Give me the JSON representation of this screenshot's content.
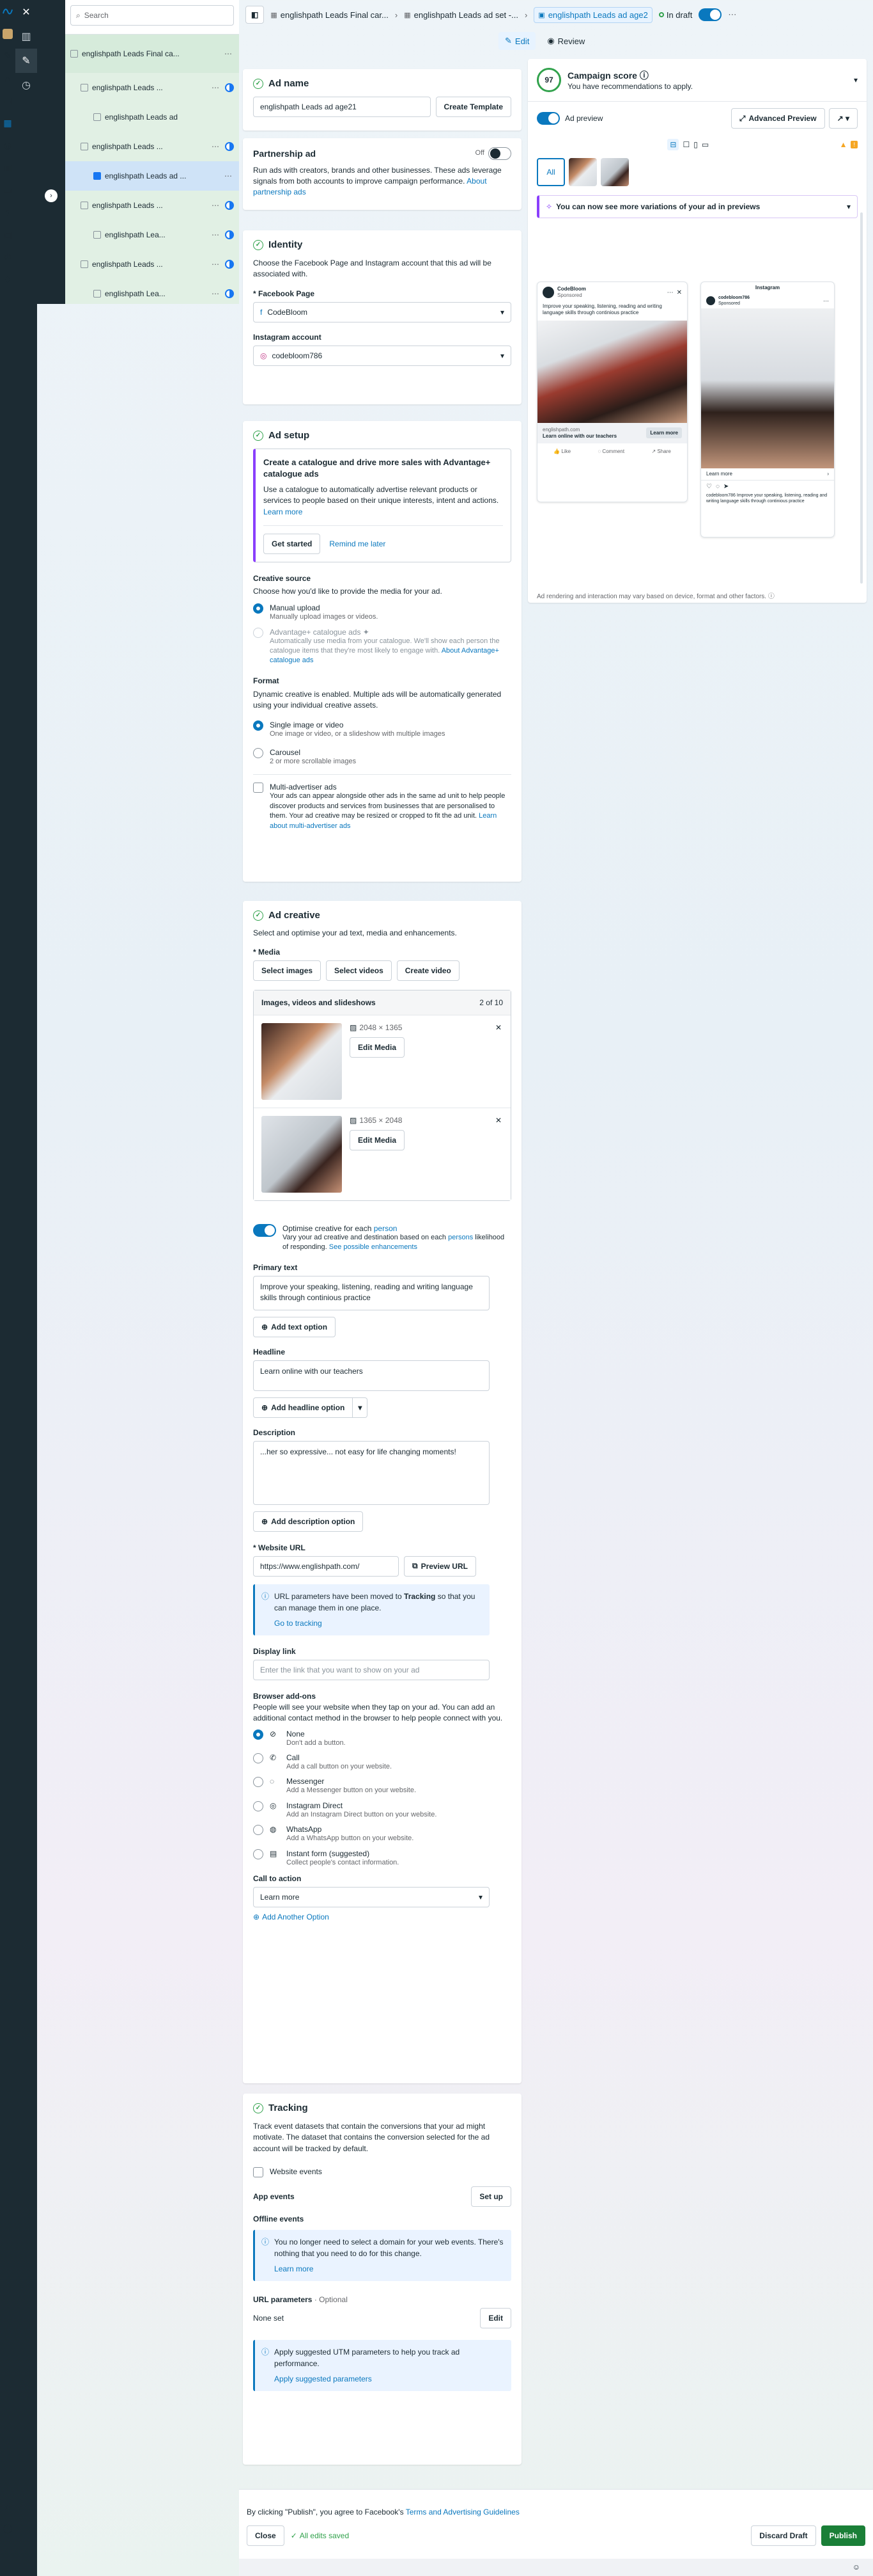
{
  "search": {
    "placeholder": "Search"
  },
  "tree": {
    "items": [
      {
        "label": "englishpath Leads Final ca..."
      },
      {
        "label": "englishpath Leads ..."
      },
      {
        "label": "englishpath Leads ad"
      },
      {
        "label": "englishpath Leads ..."
      },
      {
        "label": "englishpath Leads ad ..."
      },
      {
        "label": "englishpath Leads ..."
      },
      {
        "label": "englishpath Lea..."
      },
      {
        "label": "englishpath Leads ..."
      },
      {
        "label": "englishpath Lea..."
      }
    ]
  },
  "topbar": {
    "crumb1": "englishpath Leads Final car...",
    "crumb2": "englishpath Leads ad set -...",
    "crumb3": "englishpath Leads ad age2",
    "status": "In draft",
    "edit": "Edit",
    "review": "Review"
  },
  "adname": {
    "title": "Ad name",
    "value": "englishpath Leads ad age21",
    "create_template": "Create Template"
  },
  "partnership": {
    "title": "Partnership ad",
    "toggle": "Off",
    "desc": "Run ads with creators, brands and other businesses. These ads leverage signals from both accounts to improve campaign performance.",
    "link": "About partnership ads"
  },
  "identity": {
    "title": "Identity",
    "desc": "Choose the Facebook Page and Instagram account that this ad will be associated with.",
    "fb_label": "* Facebook Page",
    "fb_value": "CodeBloom",
    "ig_label": "Instagram account",
    "ig_value": "codebloom786"
  },
  "adsetup": {
    "title": "Ad setup",
    "promo_title": "Create a catalogue and drive more sales with Advantage+ catalogue ads",
    "promo_desc": "Use a catalogue to automatically advertise relevant products or services to people based on their unique interests, intent and actions.",
    "promo_link": "Learn more",
    "get_started": "Get started",
    "remind": "Remind me later",
    "creative_source": "Creative source",
    "creative_source_desc": "Choose how you'd like to provide the media for your ad.",
    "manual_title": "Manual upload",
    "manual_desc": "Manually upload images or videos.",
    "adv_title": "Advantage+ catalogue ads",
    "adv_desc": "Automatically use media from your catalogue. We'll show each person the catalogue items that they're most likely to engage with.",
    "adv_link": "About Advantage+ catalogue ads",
    "format": "Format",
    "format_desc": "Dynamic creative is enabled. Multiple ads will be automatically generated using your individual creative assets.",
    "single_title": "Single image or video",
    "single_desc": "One image or video, or a slideshow with multiple images",
    "carousel_title": "Carousel",
    "carousel_desc": "2 or more scrollable images",
    "multi_title": "Multi-advertiser ads",
    "multi_desc": "Your ads can appear alongside other ads in the same ad unit to help people discover products and services from businesses that are personalised to them. Your ad creative may be resized or cropped to fit the ad unit.",
    "multi_link": "Learn about multi-advertiser ads"
  },
  "creative": {
    "title": "Ad creative",
    "desc": "Select and optimise your ad text, media and enhancements.",
    "media_label": "* Media",
    "select_images": "Select images",
    "select_videos": "Select videos",
    "create_video": "Create video",
    "media_header": "Images, videos and slideshows",
    "media_count": "2 of 10",
    "media": [
      {
        "dims": "2048 × 1365",
        "edit": "Edit Media"
      },
      {
        "dims": "1365 × 2048",
        "edit": "Edit Media"
      }
    ],
    "optimise_prefix": "Optimise creative for each",
    "optimise_person": "person",
    "optimise_desc": "Vary your ad creative and destination based on each",
    "optimise_desc2": "persons",
    "optimise_desc3": "likelihood of responding.",
    "optimise_link": "See possible enhancements",
    "primary_label": "Primary text",
    "primary_value": "Improve your speaking, listening, reading and writing language skills through continious practice",
    "add_text": "Add text option",
    "headline_label": "Headline",
    "headline_value": "Learn online with our teachers",
    "add_headline": "Add headline option",
    "desc_label": "Description",
    "desc_value": "...her so expressive... not easy for life changing moments!",
    "add_desc": "Add description option",
    "url_label": "* Website URL",
    "url_value": "https://www.englishpath.com/",
    "preview_url": "Preview URL",
    "url_info_a": "URL parameters have been moved to",
    "url_info_b": "Tracking",
    "url_info_c": "so that you can manage them in one place.",
    "url_info_link": "Go to tracking",
    "display_label": "Display link",
    "display_placeholder": "Enter the link that you want to show on your ad",
    "browser_title": "Browser add-ons",
    "browser_desc": "People will see your website when they tap on your ad. You can add an additional contact method in the browser to help people connect with you.",
    "addons": [
      {
        "title": "None",
        "desc": "Don't add a button.",
        "icon": "none-icon"
      },
      {
        "title": "Call",
        "desc": "Add a call button on your website.",
        "icon": "phone-icon"
      },
      {
        "title": "Messenger",
        "desc": "Add a Messenger button on your website.",
        "icon": "messenger-icon"
      },
      {
        "title": "Instagram Direct",
        "desc": "Add an Instagram Direct button on your website.",
        "icon": "instagram-icon"
      },
      {
        "title": "WhatsApp",
        "desc": "Add a WhatsApp button on your website.",
        "icon": "whatsapp-icon"
      },
      {
        "title": "Instant form (suggested)",
        "desc": "Collect people's contact information.",
        "icon": "form-icon"
      }
    ],
    "cta_label": "Call to action",
    "cta_value": "Learn more",
    "add_option": "Add Another Option"
  },
  "tracking": {
    "title": "Tracking",
    "desc": "Track event datasets that contain the conversions that your ad might motivate. The dataset that contains the conversion selected for the ad account will be tracked by default.",
    "website_events": "Website events",
    "app_events": "App events",
    "setup": "Set up",
    "offline_events": "Offline events",
    "offline_info": "You no longer need to select a domain for your web events. There's nothing that you need to do for this change.",
    "learn_more": "Learn more",
    "url_params": "URL parameters",
    "optional": "· Optional",
    "none_set": "None set",
    "edit": "Edit",
    "utm_info": "Apply suggested UTM parameters to help you track ad performance.",
    "utm_link": "Apply suggested parameters"
  },
  "preview": {
    "score": "97",
    "score_title": "Campaign score",
    "score_desc": "You have recommendations to apply.",
    "ad_preview": "Ad preview",
    "advanced": "Advanced Preview",
    "all": "All",
    "banner": "You can now see more variations of your ad in previews",
    "fb_page": "CodeBloom",
    "fb_sponsored": "Sponsored",
    "fb_text": "Improve your speaking, listening, reading and writing language skills through continious practice",
    "fb_domain": "englishpath.com",
    "fb_headline": "Learn online with our teachers",
    "fb_cta": "Learn more",
    "like": "Like",
    "comment": "Comment",
    "share": "Share",
    "ig_title": "Instagram",
    "ig_account": "codebloom786",
    "ig_sponsored": "Sponsored",
    "ig_cta": "Learn more",
    "ig_caption": "codebloom786 Improve your speaking, listening, reading and writing language skills through continious practice",
    "note": "Ad rendering and interaction may vary based on device, format and other factors."
  },
  "footer": {
    "terms_a": "By clicking \"Publish\", you agree to Facebook's",
    "terms_link": "Terms and Advertising Guidelines",
    "close": "Close",
    "saved": "All edits saved",
    "discard": "Discard Draft",
    "publish": "Publish"
  }
}
